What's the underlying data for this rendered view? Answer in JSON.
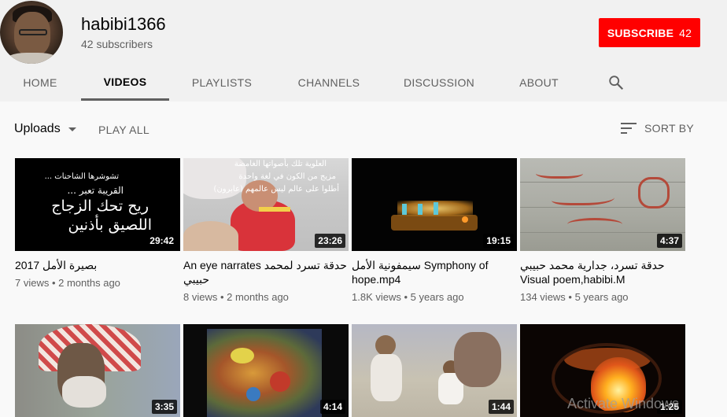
{
  "channel": {
    "name": "habibi1366",
    "subscribers": "42 subscribers",
    "subscribe_label": "SUBSCRIBE",
    "subscribe_count": "42",
    "brand_color": "#ff0000"
  },
  "tabs": [
    {
      "label": "HOME"
    },
    {
      "label": "VIDEOS",
      "active": true
    },
    {
      "label": "PLAYLISTS"
    },
    {
      "label": "CHANNELS"
    },
    {
      "label": "DISCUSSION"
    },
    {
      "label": "ABOUT"
    }
  ],
  "toolbar": {
    "uploads_label": "Uploads",
    "play_all_label": "PLAY ALL",
    "sort_by_label": "SORT BY"
  },
  "videos": [
    {
      "title": "بصيرة الأمل 2017",
      "views": "7 views",
      "age": "2 months ago",
      "duration": "29:42",
      "thumb_text": [
        "... تشوشرها الشاحنات",
        "... القريبة تعبر",
        "ريح تحك الزجاج",
        "اللصيق بأذنين"
      ]
    },
    {
      "title": "An eye narrates حدقة تسرد لمحمد حبيبي",
      "views": "8 views",
      "age": "2 months ago",
      "duration": "23:26",
      "thumb_text": [
        "العلوية تلك بأصواتها الغامضة",
        "مزيج من الكون في لغة واحدة",
        "(عابرون) أطلوا على عالم ليس عالمهم"
      ]
    },
    {
      "title": "سيمفونية الأمل Symphony of hope.mp4",
      "views": "1.8K views",
      "age": "5 years ago",
      "duration": "19:15"
    },
    {
      "title": "حدقة تسرد، جدارية محمد حبيبي Visual poem,habibi.M",
      "views": "134 views",
      "age": "5 years ago",
      "duration": "4:37"
    },
    {
      "duration": "3:35"
    },
    {
      "duration": "4:14"
    },
    {
      "duration": "1:44"
    },
    {
      "duration": "1:25"
    }
  ],
  "watermark": "Activate Windows"
}
